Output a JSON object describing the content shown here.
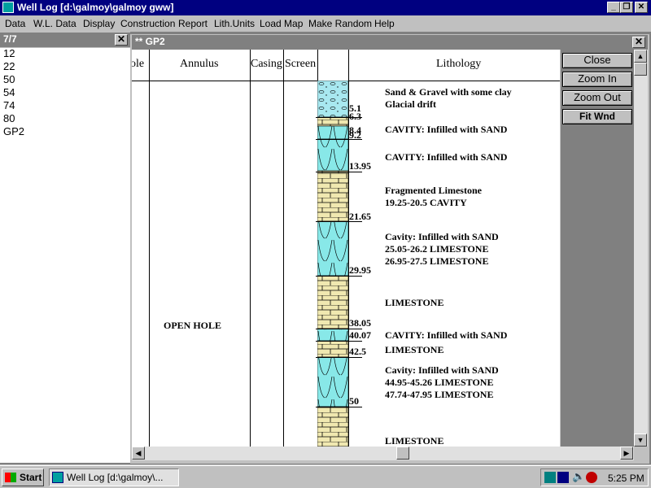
{
  "window": {
    "title": "Well Log [d:\\galmoy\\galmoy gww]"
  },
  "menu": [
    {
      "label": "Data",
      "key": "D"
    },
    {
      "label": "W.L. Data",
      "key": "W"
    },
    {
      "label": "Display",
      "key": "D"
    },
    {
      "label": "Construction",
      "key": "C"
    },
    {
      "label": "Report",
      "key": "R"
    },
    {
      "label": "Lith.Units",
      "key": "L"
    },
    {
      "label": "Load Map",
      "key": "M"
    },
    {
      "label": "Make Random",
      "key": "a"
    },
    {
      "label": "Help",
      "key": "H"
    }
  ],
  "list_window": {
    "title": "7/7",
    "items": [
      "12",
      "22",
      "50",
      "54",
      "74",
      "80",
      "GP2"
    ]
  },
  "log_window": {
    "title": "** GP2",
    "columns": [
      "ole",
      "Annulus",
      "Casing",
      "Screen",
      "Lithology"
    ],
    "annulus_label": "OPEN HOLE",
    "depths": [
      "5.1",
      "6.3",
      "8.4",
      "9.2",
      "13.95",
      "21.65",
      "29.95",
      "38.05",
      "40.07",
      "42.5",
      "50"
    ],
    "lithology": [
      [
        "Sand & Gravel with some clay",
        "Glacial drift"
      ],
      [
        "CAVITY: Infilled with SAND"
      ],
      [
        "CAVITY: Infilled with SAND"
      ],
      [
        "Fragmented Limestone",
        "19.25-20.5 CAVITY"
      ],
      [
        "Cavity: Infilled with SAND",
        "25.05-26.2 LIMESTONE",
        "26.95-27.5 LIMESTONE"
      ],
      [
        "LIMESTONE"
      ],
      [
        "CAVITY: Infilled with SAND"
      ],
      [
        "LIMESTONE"
      ],
      [
        "Cavity: Infilled with SAND",
        "44.95-45.26 LIMESTONE",
        "47.74-47.95 LIMESTONE"
      ],
      [
        "LIMESTONE"
      ]
    ],
    "buttons": {
      "close": "Close",
      "zoom_in": "Zoom In",
      "zoom_out": "Zoom Out",
      "fit": "Fit Wnd"
    }
  },
  "taskbar": {
    "start": "Start",
    "task": "Well Log [d:\\galmoy\\...",
    "clock": "5:25 PM"
  },
  "colors": {
    "titlebar_active": "#000080",
    "titlebar_inactive": "#808080",
    "cavity_fill": "#88e8e8",
    "limestone_fill": "#f0e8b0",
    "drift_fill": "#a8e8f0"
  }
}
